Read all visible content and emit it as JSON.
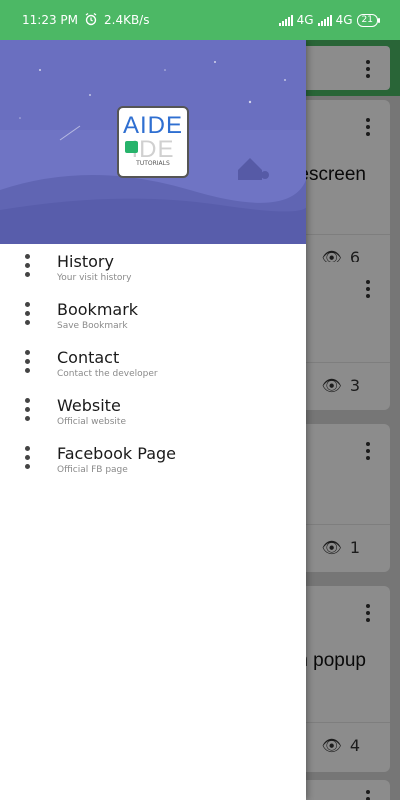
{
  "status_bar": {
    "time": "11:23 PM",
    "speed": "2.4KB/s",
    "net1": "4G",
    "net2": "4G",
    "battery": "21",
    "color": "#4cb865"
  },
  "drawer": {
    "logo": {
      "line1": "AIDE",
      "line2": "IDE",
      "sub": "TUTORIALS"
    },
    "items": [
      {
        "title": "History",
        "subtitle": "Your visit history"
      },
      {
        "title": "Bookmark",
        "subtitle": "Save Bookmark"
      },
      {
        "title": "Contact",
        "subtitle": "Contact the developer"
      },
      {
        "title": "Website",
        "subtitle": "Official website"
      },
      {
        "title": "Facebook Page",
        "subtitle": "Official FB page"
      }
    ]
  },
  "background": {
    "cards": [
      {
        "title": "escreen",
        "views": "6"
      },
      {
        "title": "",
        "views": "3"
      },
      {
        "title": "",
        "views": "1"
      },
      {
        "title": "n popup",
        "views": "4"
      }
    ]
  }
}
